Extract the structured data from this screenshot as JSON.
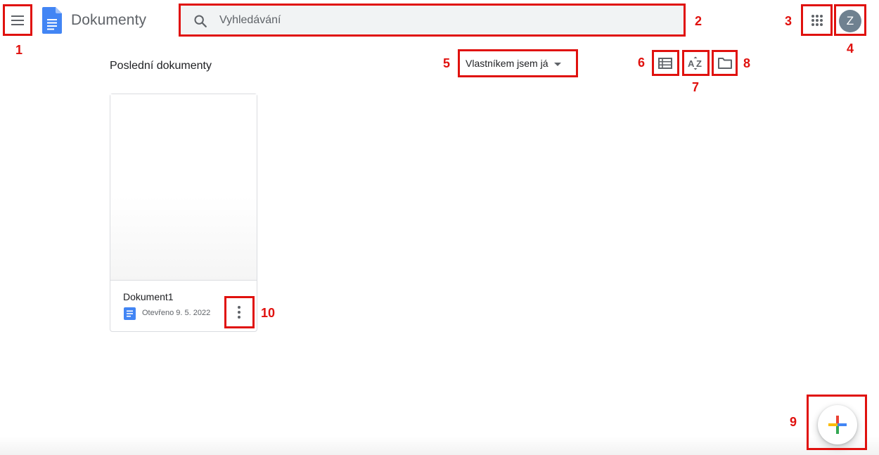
{
  "app": {
    "title": "Dokumenty"
  },
  "search": {
    "placeholder": "Vyhledávání"
  },
  "account": {
    "avatar_letter": "Z"
  },
  "toolbar": {
    "section_title": "Poslední dokumenty",
    "owner_filter": "Vlastníkem jsem já"
  },
  "documents": [
    {
      "name": "Dokument1",
      "meta": "Otevřeno 9. 5. 2022"
    }
  ],
  "annotations": [
    "1",
    "2",
    "3",
    "4",
    "5",
    "6",
    "7",
    "8",
    "9",
    "10"
  ],
  "icons": {
    "menu": "hamburger-menu-icon",
    "logo": "google-docs-logo",
    "search": "search-icon",
    "apps": "apps-grid-icon",
    "list_view": "list-view-icon",
    "sort": "sort-az-icon",
    "folder": "folder-icon",
    "more": "more-vert-icon",
    "create": "plus-icon"
  },
  "colors": {
    "annotation_red": "#e0110e",
    "docs_blue": "#4285f4",
    "search_bg": "#f1f3f4",
    "avatar_bg": "#6f8190"
  }
}
